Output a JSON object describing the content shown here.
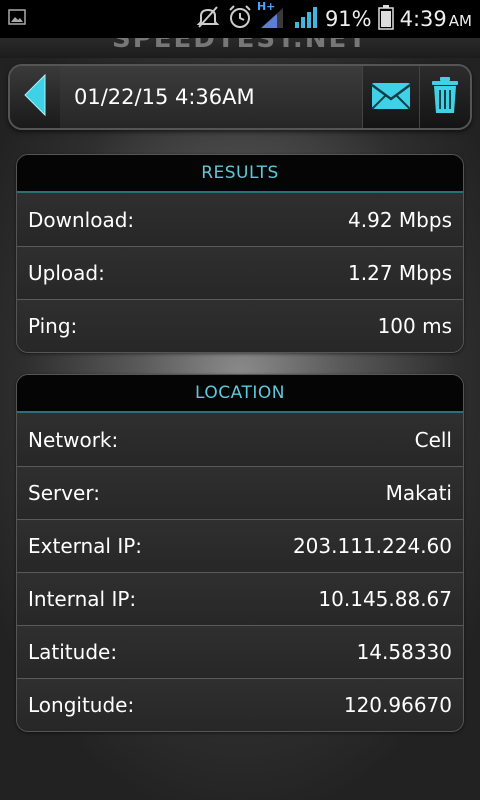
{
  "status_bar": {
    "battery_percent": "91%",
    "time": "4:39",
    "ampm": "AM",
    "icons": [
      "image-icon",
      "mute-icon",
      "alarm-icon",
      "signal-hplus-icon",
      "signal-icon",
      "battery-icon"
    ],
    "network_label": "H+"
  },
  "app_title": "SPEEDTEST.NET",
  "toolbar": {
    "title": "01/22/15 4:36AM",
    "accent": "#3fd2e6"
  },
  "results": {
    "header": "RESULTS",
    "rows": [
      {
        "label": "Download:",
        "value": "4.92 Mbps"
      },
      {
        "label": "Upload:",
        "value": "1.27 Mbps"
      },
      {
        "label": "Ping:",
        "value": "100 ms"
      }
    ]
  },
  "location": {
    "header": "LOCATION",
    "rows": [
      {
        "label": "Network:",
        "value": "Cell"
      },
      {
        "label": "Server:",
        "value": "Makati"
      },
      {
        "label": "External IP:",
        "value": "203.111.224.60"
      },
      {
        "label": "Internal IP:",
        "value": "10.145.88.67"
      },
      {
        "label": "Latitude:",
        "value": "14.58330"
      },
      {
        "label": "Longitude:",
        "value": "120.96670"
      }
    ]
  }
}
